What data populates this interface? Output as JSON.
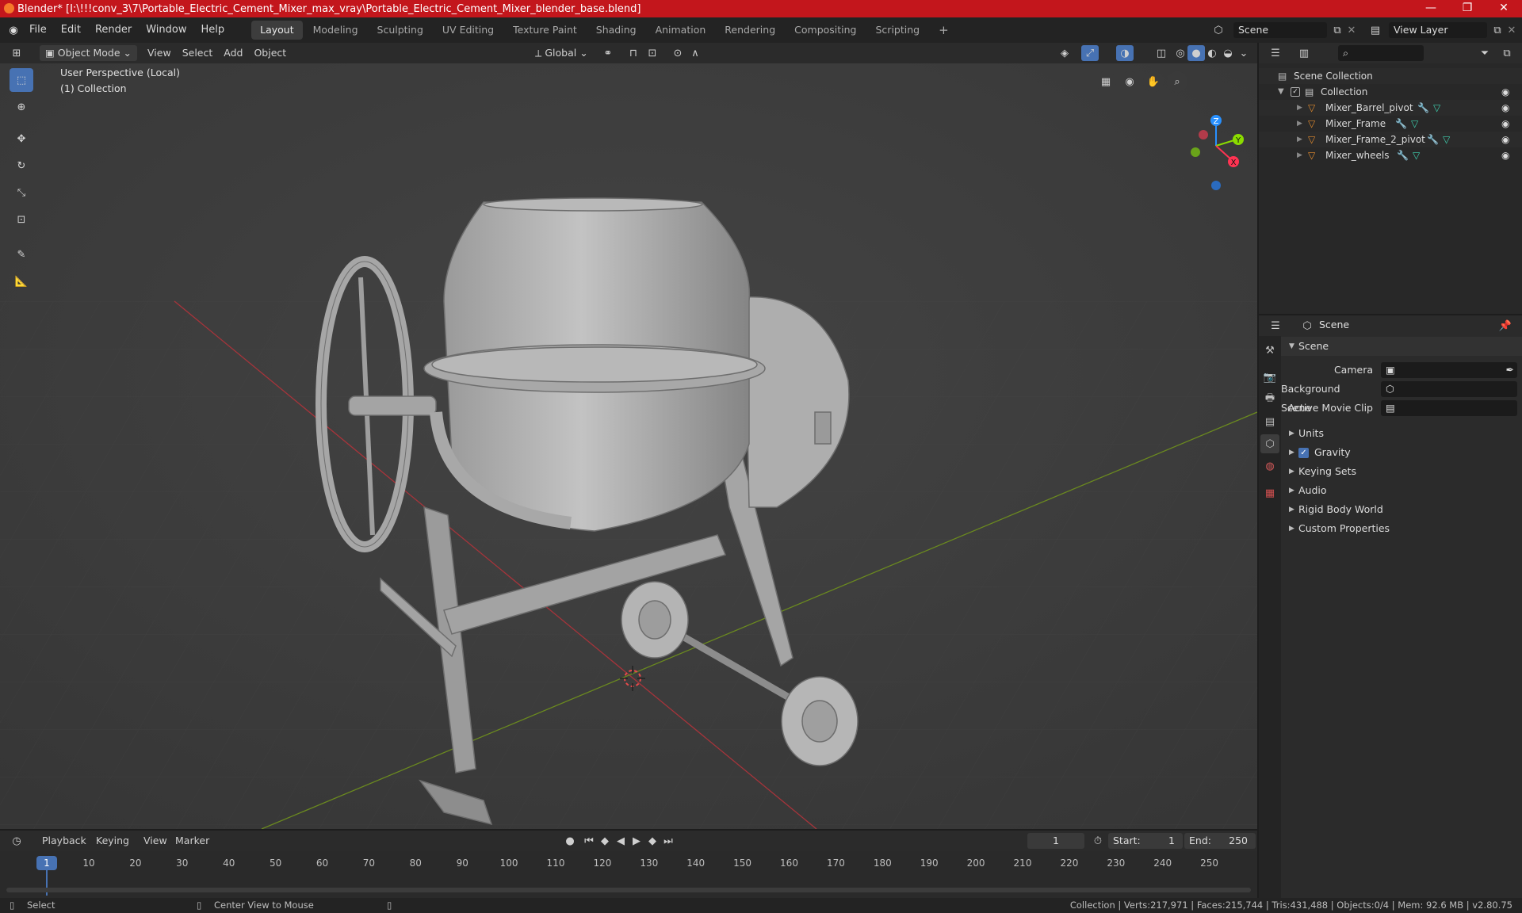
{
  "window": {
    "title": "Blender* [I:\\!!!conv_3\\7\\Portable_Electric_Cement_Mixer_max_vray\\Portable_Electric_Cement_Mixer_blender_base.blend]",
    "controls": [
      "—",
      "❐",
      "✕"
    ]
  },
  "menu": {
    "items": [
      "File",
      "Edit",
      "Render",
      "Window",
      "Help"
    ],
    "workspaces": [
      "Layout",
      "Modeling",
      "Sculpting",
      "UV Editing",
      "Texture Paint",
      "Shading",
      "Animation",
      "Rendering",
      "Compositing",
      "Scripting"
    ],
    "active_workspace": "Layout",
    "add_tab": "+",
    "scene_name": "Scene",
    "view_layer": "View Layer"
  },
  "viewport_header": {
    "mode": "Object Mode",
    "menus": [
      "View",
      "Select",
      "Add",
      "Object"
    ],
    "transform_orientation": "Global"
  },
  "viewport": {
    "perspective_label": "User Perspective (Local)",
    "collection_label": "(1) Collection",
    "gizmo_axes": {
      "z": "Z",
      "y": "Y",
      "x": "X"
    }
  },
  "outliner": {
    "root": "Scene Collection",
    "collection": "Collection",
    "objects": [
      "Mixer_Barrel_pivot",
      "Mixer_Frame",
      "Mixer_Frame_2_pivot",
      "Mixer_wheels"
    ]
  },
  "properties": {
    "header": "Scene",
    "panel_title": "Scene",
    "fields": [
      {
        "label": "Camera"
      },
      {
        "label": "Background Scene"
      },
      {
        "label": "Active Movie Clip"
      }
    ],
    "sections": [
      "Units",
      "Gravity",
      "Keying Sets",
      "Audio",
      "Rigid Body World",
      "Custom Properties"
    ],
    "gravity_checked": true
  },
  "timeline": {
    "menus": [
      "Playback",
      "Keying",
      "View",
      "Marker"
    ],
    "current_frame": "1",
    "start_label": "Start:",
    "start": "1",
    "end_label": "End:",
    "end": "250",
    "ticks": [
      "1",
      "10",
      "20",
      "30",
      "40",
      "50",
      "60",
      "70",
      "80",
      "90",
      "100",
      "110",
      "120",
      "130",
      "140",
      "150",
      "160",
      "170",
      "180",
      "190",
      "200",
      "210",
      "220",
      "230",
      "240",
      "250"
    ]
  },
  "status": {
    "left_action": "Select",
    "middle_action": "Center View to Mouse",
    "stats": "Collection | Verts:217,971 | Faces:215,744 | Tris:431,488 | Objects:0/4 | Mem: 92.6 MB | v2.80.75"
  },
  "colors": {
    "title_bar": "#c3161c",
    "active_blue": "#4772b3",
    "mesh_icon": "#e08a2e",
    "axis_x": "#ff3352",
    "axis_y": "#8bdc00",
    "axis_z": "#2890ff"
  }
}
